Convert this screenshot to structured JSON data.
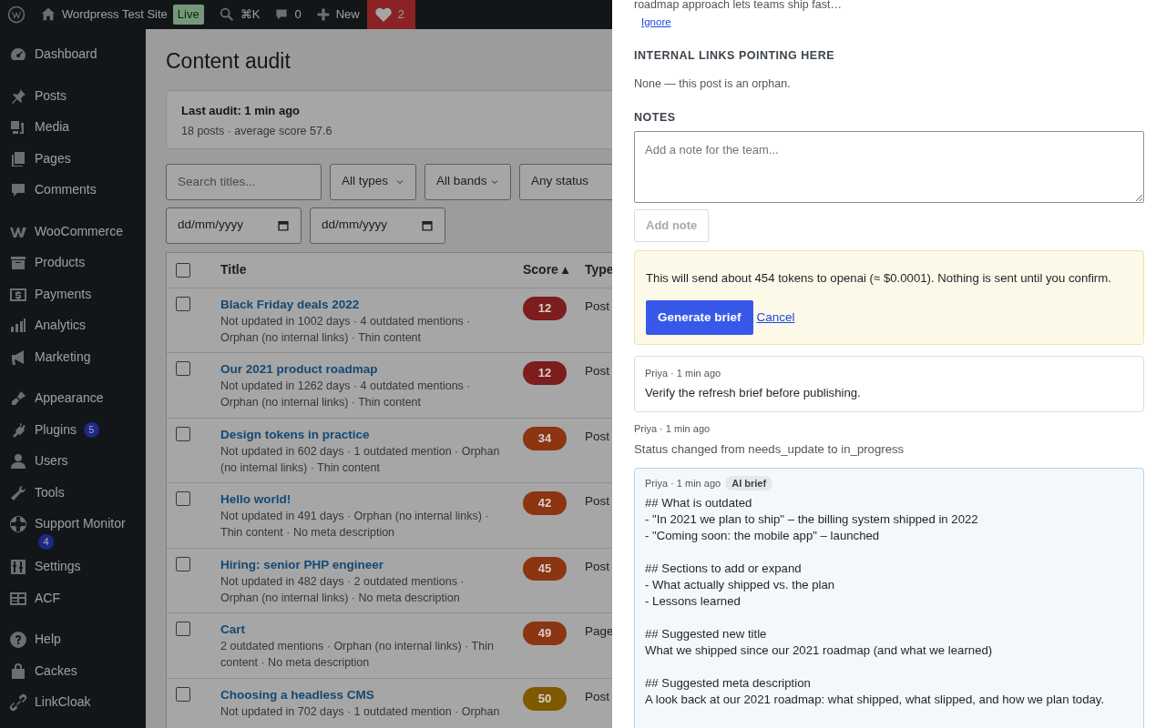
{
  "admin_bar": {
    "site": "Wordpress Test Site",
    "live_badge": "Live",
    "shortcut": "⌘K",
    "comments": "0",
    "new": "New",
    "alerts": "2"
  },
  "sidebar": {
    "groups": [
      [
        {
          "label": "Dashboard"
        }
      ],
      [
        {
          "label": "Posts"
        },
        {
          "label": "Media"
        },
        {
          "label": "Pages"
        },
        {
          "label": "Comments"
        }
      ],
      [
        {
          "label": "WooCommerce"
        },
        {
          "label": "Products"
        },
        {
          "label": "Payments"
        },
        {
          "label": "Analytics"
        },
        {
          "label": "Marketing"
        }
      ],
      [
        {
          "label": "Appearance"
        },
        {
          "label": "Plugins",
          "badge": "5"
        },
        {
          "label": "Users"
        },
        {
          "label": "Tools"
        },
        {
          "label": "Support Monitor",
          "badge": "4"
        },
        {
          "label": "Settings"
        },
        {
          "label": "ACF"
        }
      ],
      [
        {
          "label": "Help"
        },
        {
          "label": "Cackes"
        },
        {
          "label": "LinkCloak"
        }
      ]
    ]
  },
  "page": {
    "title": "Content audit",
    "summary": {
      "title": "Last audit: 1 min ago",
      "text": "18 posts · average score 57.6"
    },
    "filters": {
      "search": {
        "placeholder": "Search titles..."
      },
      "selects": [
        "All types",
        "All bands",
        "Any status"
      ],
      "dates": [
        "dd/mm/yyyy",
        "dd/mm/yyyy"
      ]
    },
    "table": {
      "columns": [
        "Title",
        "Score ▴",
        "Type"
      ],
      "select_all": {
        "checked": false
      },
      "rows": [
        {
          "checked": false,
          "title": "Black Friday deals 2022",
          "details": "Not updated in 1002 days · 4 outdated mentions · Orphan (no internal links) · Thin content",
          "score": "12",
          "color": "#7d1d1d",
          "type": "Post"
        },
        {
          "checked": false,
          "title": "Our 2021 product roadmap",
          "details": "Not updated in 1262 days · 4 outdated mentions · Orphan (no internal links) · Thin content",
          "score": "12",
          "color": "#7d1d1d",
          "type": "Post"
        },
        {
          "checked": false,
          "title": "Design tokens in practice",
          "details": "Not updated in 602 days · 1 outdated mention · Orphan (no internal links) · Thin content",
          "score": "34",
          "color": "#8b3512",
          "type": "Post"
        },
        {
          "checked": false,
          "title": "Hello world!",
          "details": "Not updated in 491 days · Orphan (no internal links) · Thin content · No meta description",
          "score": "42",
          "color": "#8b3512",
          "type": "Post"
        },
        {
          "checked": false,
          "title": "Hiring: senior PHP engineer",
          "details": "Not updated in 482 days · 2 outdated mentions · Orphan (no internal links) · No meta description",
          "score": "45",
          "color": "#8b3512",
          "type": "Post"
        },
        {
          "checked": false,
          "title": "Cart",
          "details": "2 outdated mentions · Orphan (no internal links) · Thin content · No meta description",
          "score": "49",
          "color": "#8b3512",
          "type": "Page"
        },
        {
          "checked": false,
          "title": "Choosing a headless CMS",
          "details": "Not updated in 702 days · 1 outdated mention · Orphan",
          "score": "50",
          "color": "#7d5a00",
          "type": "Post"
        }
      ]
    }
  },
  "drawer": {
    "excerpt": "roadmap approach lets teams ship fast…",
    "ignore_link": "Ignore",
    "links_heading": "INTERNAL LINKS POINTING HERE",
    "links_text": "None — this post is an orphan.",
    "notes_heading": "NOTES",
    "note_field": {
      "placeholder": "Add a note for the team..."
    },
    "add_note": {
      "label": "Add note",
      "disabled": true
    },
    "confirm": {
      "text": "This will send about 454 tokens to openai (≈ $0.0001). Nothing is sent until you confirm.",
      "generate": "Generate brief",
      "cancel": "Cancel"
    },
    "entries": [
      {
        "kind": "note",
        "meta": "Priya · 1 min ago",
        "text": "Verify the refresh brief before publishing."
      },
      {
        "kind": "status",
        "meta": "Priya · 1 min ago",
        "text": "Status changed from needs_update to in_progress"
      },
      {
        "kind": "brief",
        "meta": "Priya · 1 min ago",
        "tag": "AI brief",
        "sections": [
          {
            "heading": "## What is outdated",
            "lines": [
              "- \"In 2021 we plan to ship\" – the billing system shipped in 2022",
              "- \"Coming soon: the mobile app\" – launched"
            ]
          },
          {
            "heading": "## Sections to add or expand",
            "lines": [
              "- What actually shipped vs. the plan",
              "- Lessons learned"
            ]
          },
          {
            "heading": "## Suggested new title",
            "lines": [
              "What we shipped since our 2021 roadmap (and what we learned)"
            ]
          },
          {
            "heading": "## Suggested meta description",
            "lines": [
              "A look back at our 2021 roadmap: what shipped, what slipped, and how we plan today."
            ]
          }
        ]
      }
    ]
  }
}
